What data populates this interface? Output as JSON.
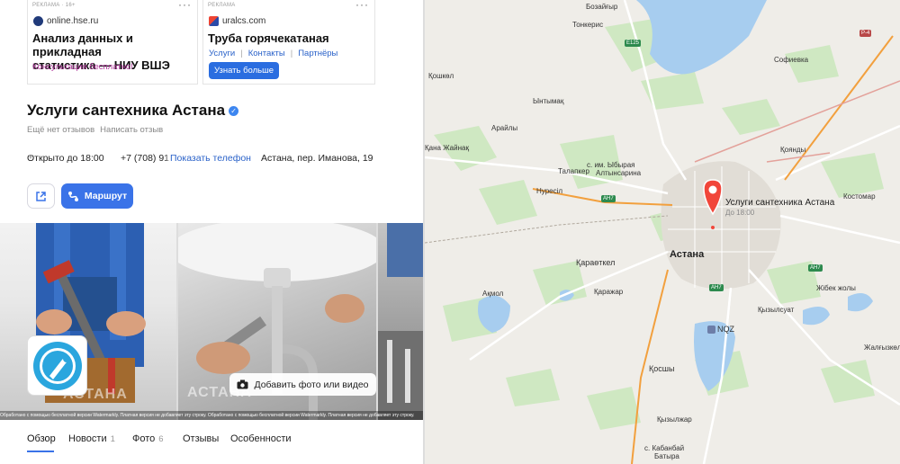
{
  "ads": [
    {
      "label": "РЕКЛАМА · 16+",
      "source": "online.hse.ru",
      "title_line1": "Анализ данных и прикладная",
      "title_line2": "статистика — НИУ ВШЭ",
      "note": "Консультация бесплатно!"
    },
    {
      "label": "РЕКЛАМА",
      "source": "uralcs.com",
      "title": "Труба горячекатаная",
      "links": [
        "Услуги",
        "Контакты",
        "Партнёры"
      ],
      "button": "Узнать больше"
    }
  ],
  "org": {
    "name": "Услуги сантехника Астана",
    "no_reviews": "Ещё нет отзывов",
    "write_review": "Написать отзыв",
    "hours": "Открыто до 18:00",
    "phone": "+7 (708) 91",
    "show_phone": "Показать телефон",
    "address": "Астана, пер. Иманова, 19"
  },
  "actions": {
    "route": "Маршрут"
  },
  "photos": {
    "watermark": "АСТАНА",
    "add_media": "Добавить фото или видео",
    "strip_text": "Обработано с помощью бесплатной версии Watermarkly. Платная версия не добавляет эту строку. Обработано с помощью бесплатной версии Watermarkly. Платная версия не добавляет эту строку."
  },
  "tabs": [
    {
      "label": "Обзор",
      "count": ""
    },
    {
      "label": "Новости",
      "count": "1"
    },
    {
      "label": "Фото",
      "count": "6"
    },
    {
      "label": "Отзывы",
      "count": ""
    },
    {
      "label": "Особенности",
      "count": ""
    }
  ],
  "map": {
    "marker_title": "Услуги сантехника Астана",
    "marker_sub": "До 18:00",
    "city": "Астана",
    "airport": "NQZ",
    "places": {
      "bozaigyr": "Бозайғыр",
      "tonkeris": "Тонкерис",
      "sofievka": "Софиевка",
      "koshkol": "Қошкөл",
      "yntymak": "Ынтымақ",
      "arailym": "Арайлы",
      "zhainak": "Қана Жайнақ",
      "zhibyr": "с. им. Ыбырая",
      "altynsarin": "Алтынсарина",
      "talapker": "Талапкер",
      "koyandy": "Қоянды",
      "nuresil": "Нуресіл",
      "kostomar": "Костомар",
      "karaotkel": "Қараөткел",
      "karazhar": "Қаражар",
      "akmol": "Ақмол",
      "zhibek": "Жібек жолы",
      "kosshy": "Қосшы",
      "kyzylsuat": "Қызылсуат",
      "zhalgyzkol": "Жалғызкөл",
      "kyzylzhar": "Қызылжар",
      "kabanbai": "с. Кабанбай",
      "batyra": "Батыра"
    },
    "shields": {
      "e125": "E125",
      "r4": "Р-4",
      "ah7a": "АН7",
      "ah7b": "АН7",
      "ah7c": "АН7"
    }
  }
}
